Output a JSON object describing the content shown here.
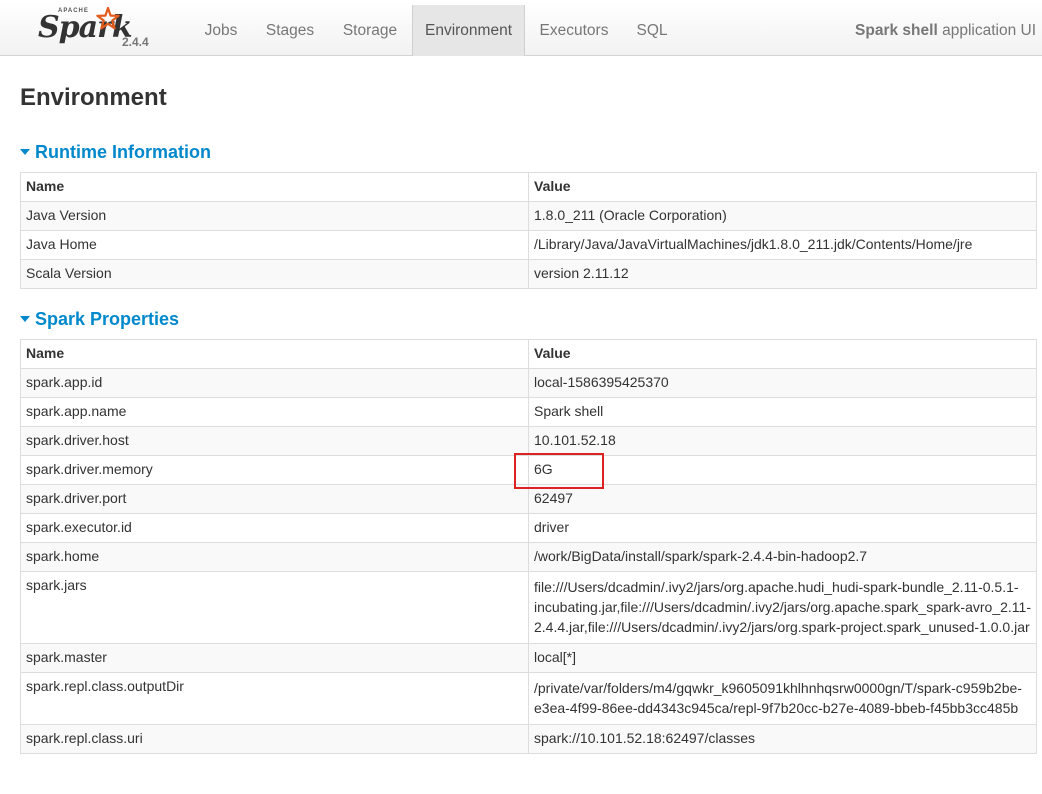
{
  "brand": {
    "apache_label": "APACHE",
    "name": "Spark",
    "version": "2.4.4",
    "star_color": "#e25a1c"
  },
  "nav": {
    "tabs": [
      {
        "label": "Jobs"
      },
      {
        "label": "Stages"
      },
      {
        "label": "Storage"
      },
      {
        "label": "Environment",
        "active": true
      },
      {
        "label": "Executors"
      },
      {
        "label": "SQL"
      }
    ],
    "app_name": "Spark shell",
    "app_suffix": "application UI"
  },
  "page": {
    "title": "Environment"
  },
  "runtime": {
    "header": "Runtime Information",
    "columns": [
      "Name",
      "Value"
    ],
    "rows": [
      {
        "name": "Java Version",
        "value": "1.8.0_211 (Oracle Corporation)"
      },
      {
        "name": "Java Home",
        "value": "/Library/Java/JavaVirtualMachines/jdk1.8.0_211.jdk/Contents/Home/jre"
      },
      {
        "name": "Scala Version",
        "value": "version 2.11.12"
      }
    ]
  },
  "spark_props": {
    "header": "Spark Properties",
    "columns": [
      "Name",
      "Value"
    ],
    "rows": [
      {
        "name": "spark.app.id",
        "value": "local-1586395425370"
      },
      {
        "name": "spark.app.name",
        "value": "Spark shell"
      },
      {
        "name": "spark.driver.host",
        "value": "10.101.52.18"
      },
      {
        "name": "spark.driver.memory",
        "value": "6G"
      },
      {
        "name": "spark.driver.port",
        "value": "62497"
      },
      {
        "name": "spark.executor.id",
        "value": "driver"
      },
      {
        "name": "spark.home",
        "value": "/work/BigData/install/spark/spark-2.4.4-bin-hadoop2.7"
      },
      {
        "name": "spark.jars",
        "value": "file:///Users/dcadmin/.ivy2/jars/org.apache.hudi_hudi-spark-bundle_2.11-0.5.1-incubating.jar,file:///Users/dcadmin/.ivy2/jars/org.apache.spark_spark-avro_2.11-2.4.4.jar,file:///Users/dcadmin/.ivy2/jars/org.spark-project.spark_unused-1.0.0.jar"
      },
      {
        "name": "spark.master",
        "value": "local[*]"
      },
      {
        "name": "spark.repl.class.outputDir",
        "value": "/private/var/folders/m4/gqwkr_k9605091khlhnhqsrw0000gn/T/spark-c959b2be-e3ea-4f99-86ee-dd4343c945ca/repl-9f7b20cc-b27e-4089-bbeb-f45bb3cc485b"
      },
      {
        "name": "spark.repl.class.uri",
        "value": "spark://10.101.52.18:62497/classes"
      }
    ]
  },
  "colors": {
    "accent_link": "#0088cc",
    "highlight_box": "#dd2222",
    "row_stripe": "#f9f9f9"
  }
}
